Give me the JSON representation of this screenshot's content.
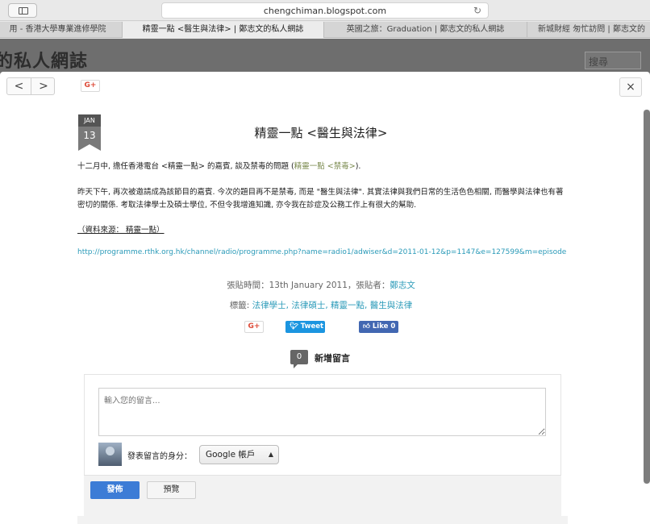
{
  "browser": {
    "url": "chengchiman.blogspot.com",
    "tabs": [
      "用 - 香港大學專業進修學院",
      "精靈一點 <醫生與法律> | 鄭志文的私人網誌",
      "英國之旅：Graduation | 鄭志文的私人網誌",
      "新城財經 匆忙訪問 | 鄭志文的"
    ],
    "active_tab": 1
  },
  "blog": {
    "title_partial": "的私人網誌",
    "search_placeholder": "搜尋"
  },
  "modal": {
    "gplus_label": "G+",
    "close_icon": "×",
    "nav": {
      "prev": "<",
      "next": ">"
    },
    "date": {
      "month": "JAN",
      "day": "13"
    },
    "post_title": "精靈一點 <醫生與法律>",
    "paragraph1_pre": "十二月中, 擔任香港電台 <精靈一點> 的嘉賓, 談及禁毒的問題 (",
    "paragraph1_link": "精靈一點 <禁毒>",
    "paragraph1_post": ").",
    "paragraph2": "昨天下午, 再次被邀請成為該節目的嘉賓. 今次的題目再不是禁毒, 而是 \"醫生與法律\". 其實法律與我們日常的生活色色相關, 而醫學與法律也有著密切的關係. 考取法律學士及碩士學位, 不但令我增進知識, 亦令我在診症及公務工作上有很大的幫助.",
    "source_text": "（資料來源： 精靈一點）",
    "link_url": "http://programme.rthk.org.hk/channel/radio/programme.php?name=radio1/adwiser&d=2011-01-12&p=1147&e=127599&m=episode",
    "meta_posted_label": "張貼時間：",
    "meta_posted_date": "13th January 2011",
    "meta_author_label": "，張貼者：",
    "meta_author": "鄭志文",
    "labels_label": "標籤: ",
    "labels": "法律學士, 法律碩士, 精靈一點, 醫生與法律",
    "share": {
      "gplus": "G+",
      "tweet": "Tweet",
      "like": "Like",
      "like_count": "0"
    },
    "comments": {
      "count": "0",
      "heading": "新增留言",
      "placeholder": "輸入您的留言...",
      "identity_label": "發表留言的身分：",
      "identity_value": "Google 帳戶",
      "publish": "發佈",
      "preview": "預覽"
    }
  },
  "colors": {
    "link": "#2a9ab8",
    "publish_button": "#3c7cd6",
    "tweet": "#1b95e0",
    "like": "#4267b2",
    "gplus_text": "#dd4b39"
  }
}
